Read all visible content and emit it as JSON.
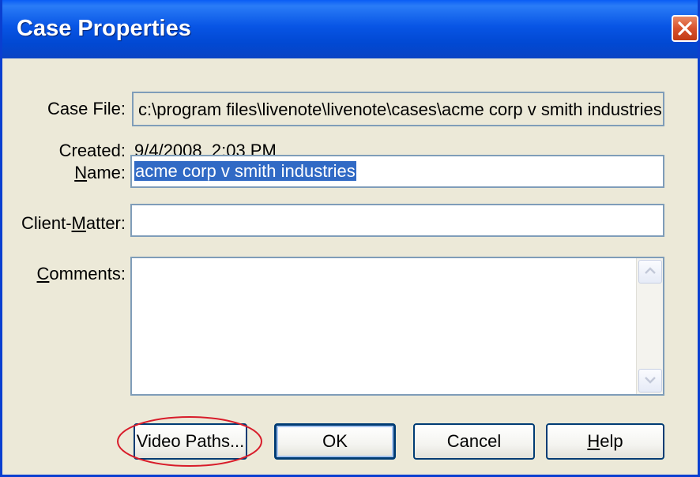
{
  "window": {
    "title": "Case Properties"
  },
  "fields": {
    "case_file": {
      "label": "Case File:",
      "value": "c:\\program files\\livenote\\livenote\\cases\\acme corp v smith industries."
    },
    "created": {
      "label": "Created:",
      "value": "9/4/2008  2:03 PM"
    },
    "name": {
      "label_prefix": "",
      "label_accel": "N",
      "label_rest": "ame:",
      "value": "acme corp v smith industries"
    },
    "client_matter": {
      "label_prefix": "Client-",
      "label_accel": "M",
      "label_rest": "atter:",
      "value": ""
    },
    "comments": {
      "label_prefix": "",
      "label_accel": "C",
      "label_rest": "omments:",
      "value": ""
    }
  },
  "buttons": {
    "video_paths": {
      "label": "Video Paths..."
    },
    "ok": {
      "label": "OK"
    },
    "cancel": {
      "label": "Cancel"
    },
    "help": {
      "accel": "H",
      "rest": "elp"
    }
  },
  "colors": {
    "titlebar": "#0a5df5",
    "close_button": "#d8512c",
    "selection": "#316ac5",
    "annotation": "#d81c2a"
  },
  "icons": {
    "close": "close-icon",
    "scroll_up": "scroll-up-arrow-icon",
    "scroll_down": "scroll-down-arrow-icon"
  }
}
